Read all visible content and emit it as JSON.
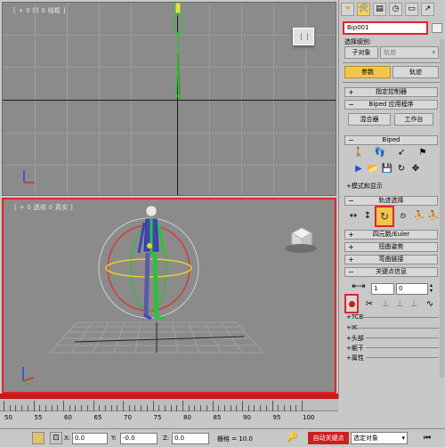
{
  "viewports": {
    "top_label": "[ + 0 前 0 线框 ]",
    "bottom_label": "[ + 0 透视 0 真实 ]"
  },
  "command_panel": {
    "tabs": [
      "☀",
      "🛠",
      "▤",
      "◷",
      "▭",
      "↗"
    ],
    "object_name": "Bip001",
    "selection_level_label": "选择级别:",
    "sub_object_button": "子对象",
    "sub_object_dropdown": "轨迹",
    "params_button": "参数",
    "trajectory_button": "轨迹",
    "rollouts": {
      "assign_controller": "指定控制器",
      "biped_apps": "Biped 应用程序",
      "biped": "Biped",
      "track_selection": "轨迹选择",
      "quaternion_euler": "四元数/Euler",
      "twist_poses": "扭曲姿势",
      "bend_links": "弯曲链接",
      "key_info": "关键点信息"
    },
    "mixer_button": "混合器",
    "workbench_button": "工作台",
    "mode_display": "+模式和显示",
    "key_number": "1",
    "key_value": "0",
    "sub_sections": [
      "+TCB",
      "+IK",
      "+头部",
      "+躯干",
      "+属性"
    ]
  },
  "timeline": {
    "tick_labels": [
      "50",
      "55",
      "60",
      "65",
      "70",
      "75",
      "80",
      "85",
      "90",
      "95",
      "100"
    ]
  },
  "status_bar": {
    "x_label": "X:",
    "x_value": "0.0",
    "y_label": "Y:",
    "y_value": "-0.0",
    "z_label": "Z:",
    "z_value": "0.0",
    "grid_label": "栅格 = 10.0",
    "auto_key": "自动关键点",
    "set_key_dropdown": "选定对象"
  },
  "colors": {
    "accent_yellow": "#f2c64a",
    "highlight_red": "#e0242a",
    "autokey_red": "#cc1f1f",
    "viewport_gray": "#8b8b8b"
  }
}
